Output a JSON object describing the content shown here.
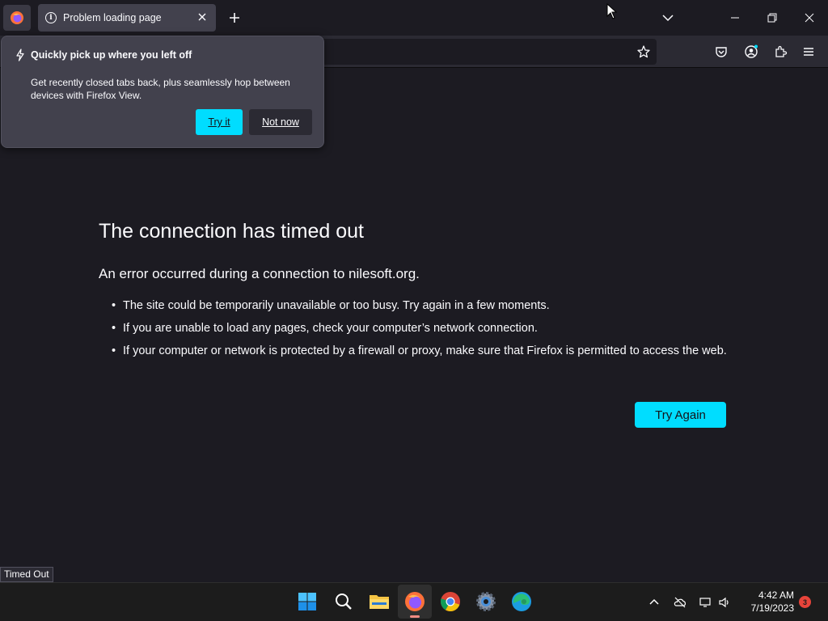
{
  "tab": {
    "title": "Problem loading page"
  },
  "popup": {
    "title": "Quickly pick up where you left off",
    "body": "Get recently closed tabs back, plus seamlessly hop between devices with Firefox View.",
    "try_label": "Try it",
    "not_now_label": "Not now"
  },
  "error": {
    "title": "The connection has timed out",
    "subtitle": "An error occurred during a connection to nilesoft.org.",
    "bullets": [
      "The site could be temporarily unavailable or too busy. Try again in a few moments.",
      "If you are unable to load any pages, check your computer’s network connection.",
      "If your computer or network is protected by a firewall or proxy, make sure that Firefox is permitted to access the web."
    ],
    "retry_label": "Try Again"
  },
  "status_bar": {
    "text": "Timed Out"
  },
  "taskbar": {
    "time": "4:42 AM",
    "date": "7/19/2023",
    "notification_count": "3"
  },
  "colors": {
    "accent": "#00ddff",
    "page_bg": "#1c1b22",
    "toolbar_bg": "#2b2a33",
    "tab_bg": "#42414d"
  }
}
